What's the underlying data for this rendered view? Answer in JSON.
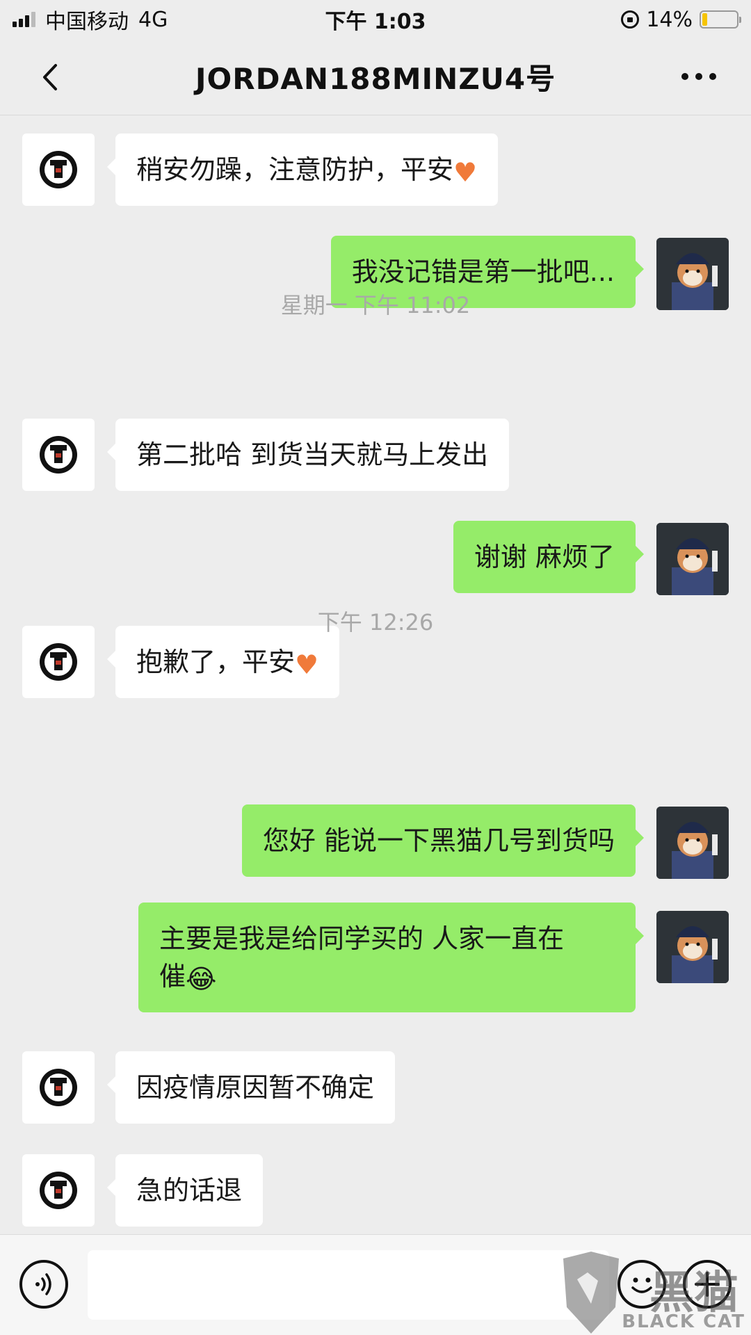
{
  "status_bar": {
    "carrier": "中国移动",
    "network": "4G",
    "time": "下午 1:03",
    "battery": "14%"
  },
  "nav": {
    "title": "JORDAN188MINZU4号"
  },
  "messages": [
    {
      "side": "them",
      "text": "稍安勿躁，注意防护，平安",
      "emoji": "heart"
    },
    {
      "side": "me",
      "text": "我没记错是第一批吧..."
    },
    {
      "type": "time",
      "text": "星期一 下午 11:02"
    },
    {
      "side": "them",
      "text": "第二批哈 到货当天就马上发出"
    },
    {
      "side": "me",
      "text": "谢谢 麻烦了"
    },
    {
      "side": "them",
      "text": "抱歉了，平安",
      "emoji": "heart"
    },
    {
      "type": "time",
      "text": "下午 12:26"
    },
    {
      "side": "me",
      "text": "您好 能说一下黑猫几号到货吗"
    },
    {
      "side": "me",
      "text_line1": "主要是我是给同学买的 人家一直在",
      "text_line2": "催",
      "emoji": "laugh-cry"
    },
    {
      "side": "them",
      "text": "因疫情原因暂不确定"
    },
    {
      "side": "them",
      "text": "急的话退"
    }
  ],
  "input_bar": {
    "voice_icon": "voice-icon",
    "emoji_icon": "smile-icon",
    "plus_icon": "plus-icon"
  },
  "watermark": {
    "cn": "黑猫",
    "en": "BLACK CAT"
  },
  "colors": {
    "background": "#ededed",
    "my_bubble": "#95ec69",
    "their_bubble": "#ffffff",
    "timestamp": "#a8a8a8"
  }
}
